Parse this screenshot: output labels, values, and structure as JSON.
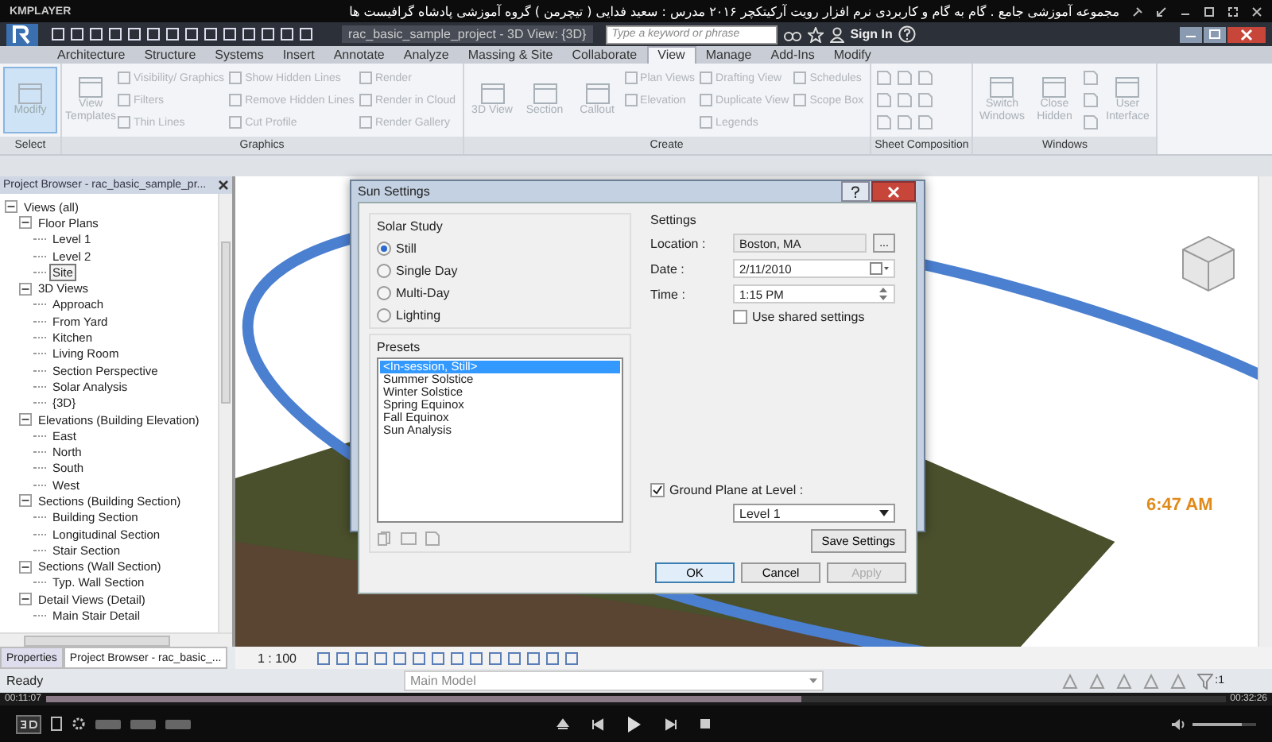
{
  "player": {
    "logo": "KMPLAYER",
    "video_title": "مجموعه آموزشی جامع . گام به گام و کاربردی نرم افزار رویت آرکیتکچر ۲۰۱۶   مدرس : سعید فدایی ( تیچرمن ) گروه آموزشی پادشاه گرافیست ها",
    "time_elapsed": "00:11:07",
    "time_total": "00:32:26",
    "progress": {
      "level": 0.64
    },
    "volume": {
      "level": 0.77
    }
  },
  "revit": {
    "document_title": "rac_basic_sample_project - 3D View: {3D}",
    "search": {
      "placeholder": "Type a keyword or phrase"
    },
    "sign_in": "Sign In",
    "tabs": [
      {
        "label": "Architecture",
        "selected": false
      },
      {
        "label": "Structure",
        "selected": false
      },
      {
        "label": "Systems",
        "selected": false
      },
      {
        "label": "Insert",
        "selected": false
      },
      {
        "label": "Annotate",
        "selected": false
      },
      {
        "label": "Analyze",
        "selected": false
      },
      {
        "label": "Massing & Site",
        "selected": false
      },
      {
        "label": "Collaborate",
        "selected": false
      },
      {
        "label": "View",
        "selected": true
      },
      {
        "label": "Manage",
        "selected": false
      },
      {
        "label": "Add-Ins",
        "selected": false
      },
      {
        "label": "Modify",
        "selected": false
      }
    ],
    "ribbon_panels": [
      {
        "label": "Select",
        "items": [
          {
            "kind": "large",
            "text": "Modify",
            "selected": true
          }
        ]
      },
      {
        "label": "Graphics",
        "items": [
          {
            "kind": "large",
            "text": "View Templates",
            "selected": false
          },
          {
            "kind": "small",
            "text": "Visibility/ Graphics",
            "selected": false
          },
          {
            "kind": "small",
            "text": "Filters",
            "selected": false
          },
          {
            "kind": "small",
            "text": "Thin Lines",
            "selected": false
          },
          {
            "kind": "small",
            "text": "Show Hidden Lines",
            "selected": false
          },
          {
            "kind": "small",
            "text": "Remove Hidden Lines",
            "selected": false
          },
          {
            "kind": "small",
            "text": "Cut Profile",
            "selected": false
          },
          {
            "kind": "small",
            "text": "Render",
            "selected": false
          },
          {
            "kind": "small",
            "text": "Render in Cloud",
            "selected": false
          },
          {
            "kind": "small",
            "text": "Render Gallery",
            "selected": false
          }
        ]
      },
      {
        "label": "Create",
        "items": [
          {
            "kind": "large",
            "text": "3D View",
            "selected": false
          },
          {
            "kind": "large",
            "text": "Section",
            "selected": false
          },
          {
            "kind": "large",
            "text": "Callout",
            "selected": false
          },
          {
            "kind": "small",
            "text": "Plan Views",
            "selected": false
          },
          {
            "kind": "small",
            "text": "Elevation",
            "selected": false
          },
          {
            "kind": "blank"
          },
          {
            "kind": "small",
            "text": "Drafting View",
            "selected": false
          },
          {
            "kind": "small",
            "text": "Duplicate View",
            "selected": false
          },
          {
            "kind": "small",
            "text": "Legends",
            "selected": false
          },
          {
            "kind": "small",
            "text": "Schedules",
            "selected": false
          },
          {
            "kind": "small",
            "text": "Scope Box",
            "selected": false
          }
        ]
      },
      {
        "label": "Sheet Composition",
        "items": [
          {
            "kind": "icon"
          },
          {
            "kind": "icon"
          },
          {
            "kind": "icon"
          },
          {
            "kind": "icon"
          },
          {
            "kind": "icon"
          },
          {
            "kind": "icon"
          },
          {
            "kind": "icon"
          },
          {
            "kind": "icon"
          },
          {
            "kind": "icon"
          }
        ]
      },
      {
        "label": "Windows",
        "items": [
          {
            "kind": "large",
            "text": "Switch Windows",
            "selected": false
          },
          {
            "kind": "large",
            "text": "Close Hidden",
            "selected": false
          },
          {
            "kind": "icon"
          },
          {
            "kind": "icon"
          },
          {
            "kind": "icon"
          },
          {
            "kind": "large",
            "text": "User Interface",
            "selected": false
          }
        ]
      }
    ],
    "project_browser": {
      "title": "Project Browser - rac_basic_sample_pr...",
      "tree": [
        {
          "label": "Views (all)",
          "expanded": true,
          "selected": false,
          "children": [
            {
              "label": "Floor Plans",
              "expanded": true,
              "selected": false,
              "children": [
                {
                  "label": "Level 1",
                  "selected": false
                },
                {
                  "label": "Level 2",
                  "selected": false
                },
                {
                  "label": "Site",
                  "selected": true
                }
              ]
            },
            {
              "label": "3D Views",
              "expanded": true,
              "selected": false,
              "children": [
                {
                  "label": "Approach",
                  "selected": false
                },
                {
                  "label": "From Yard",
                  "selected": false
                },
                {
                  "label": "Kitchen",
                  "selected": false
                },
                {
                  "label": "Living Room",
                  "selected": false
                },
                {
                  "label": "Section Perspective",
                  "selected": false
                },
                {
                  "label": "Solar Analysis",
                  "selected": false
                },
                {
                  "label": "{3D}",
                  "selected": false
                }
              ]
            },
            {
              "label": "Elevations (Building Elevation)",
              "expanded": true,
              "selected": false,
              "children": [
                {
                  "label": "East",
                  "selected": false
                },
                {
                  "label": "North",
                  "selected": false
                },
                {
                  "label": "South",
                  "selected": false
                },
                {
                  "label": "West",
                  "selected": false
                }
              ]
            },
            {
              "label": "Sections (Building Section)",
              "expanded": true,
              "selected": false,
              "children": [
                {
                  "label": "Building Section",
                  "selected": false
                },
                {
                  "label": "Longitudinal Section",
                  "selected": false
                },
                {
                  "label": "Stair Section",
                  "selected": false
                }
              ]
            },
            {
              "label": "Sections (Wall Section)",
              "expanded": true,
              "selected": false,
              "children": [
                {
                  "label": "Typ. Wall Section",
                  "selected": false
                }
              ]
            },
            {
              "label": "Detail Views (Detail)",
              "expanded": true,
              "selected": false,
              "children": [
                {
                  "label": "Main Stair Detail",
                  "selected": false
                }
              ]
            }
          ]
        }
      ]
    },
    "bottom_tabs": [
      {
        "label": "Properties",
        "selected": false
      },
      {
        "label": "Project Browser - rac_basic_...",
        "selected": true
      }
    ],
    "view_scale": "1 : 100",
    "viewport_time": "6:47 AM",
    "status": "Ready",
    "model": "Main Model",
    "filter_count": ":1"
  },
  "sun_settings": {
    "title": "Sun Settings",
    "solar_study": {
      "label": "Solar Study",
      "options": [
        {
          "label": "Still",
          "selected": true
        },
        {
          "label": "Single Day",
          "selected": false
        },
        {
          "label": "Multi-Day",
          "selected": false
        },
        {
          "label": "Lighting",
          "selected": false
        }
      ]
    },
    "presets": {
      "label": "Presets",
      "items": [
        {
          "label": "<In-session, Still>",
          "selected": true
        },
        {
          "label": "Summer Solstice",
          "selected": false
        },
        {
          "label": "Winter Solstice",
          "selected": false
        },
        {
          "label": "Spring Equinox",
          "selected": false
        },
        {
          "label": "Fall Equinox",
          "selected": false
        },
        {
          "label": "Sun Analysis",
          "selected": false
        }
      ]
    },
    "settings": {
      "label": "Settings",
      "location_label": "Location :",
      "location": "Boston, MA",
      "browse_button": "...",
      "date_label": "Date :",
      "date": "2/11/2010",
      "time_label": "Time :",
      "time": "1:15 PM",
      "use_shared": {
        "label": "Use shared settings",
        "checked": false
      },
      "ground_plane": {
        "label": "Ground Plane at Level :",
        "checked": true
      },
      "level": "Level 1",
      "save_button": "Save Settings"
    },
    "buttons": [
      {
        "label": "OK",
        "disabled": false,
        "default": true
      },
      {
        "label": "Cancel",
        "disabled": false,
        "default": false
      },
      {
        "label": "Apply",
        "disabled": true,
        "default": false
      }
    ]
  }
}
